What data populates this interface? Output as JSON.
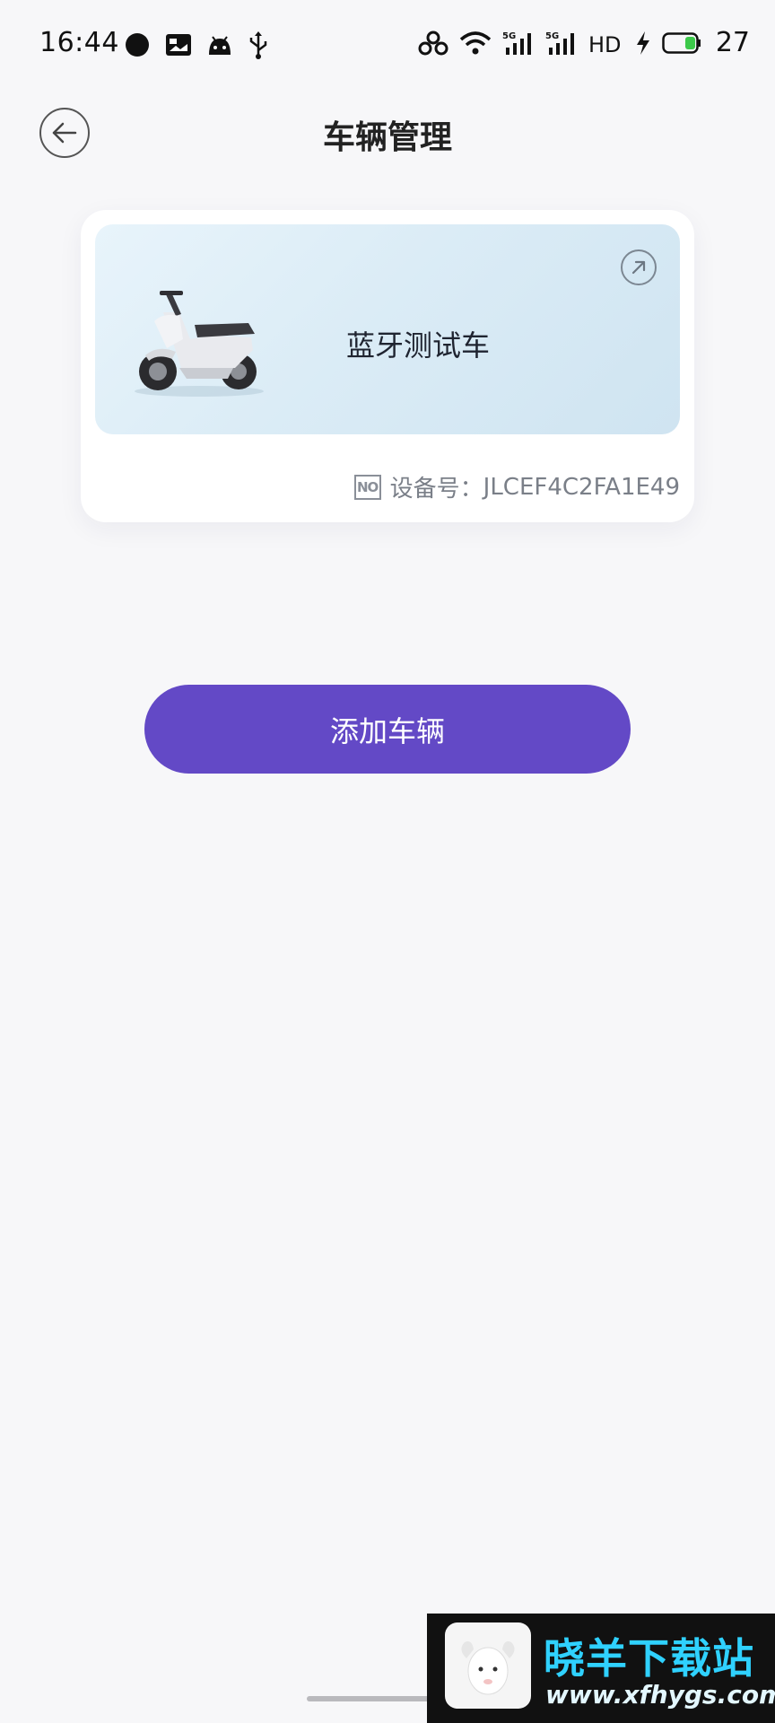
{
  "status_bar": {
    "time": "16:44",
    "battery_level": "27",
    "left_icons": [
      "chat-bubble-icon",
      "image-card-icon",
      "android-icon",
      "usb-icon"
    ],
    "right_icons": [
      "hotspot-icon",
      "wifi-icon",
      "signal-5g-icon",
      "signal-5g-icon",
      "hd-icon",
      "charging-icon",
      "battery-icon"
    ]
  },
  "header": {
    "title": "车辆管理",
    "back_icon": "back-arrow-icon"
  },
  "vehicle_card": {
    "name": "蓝牙测试车",
    "device_label": "设备号：",
    "device_id": "JLCEF4C2FA1E49",
    "badge": "NO",
    "open_icon": "arrow-up-right-icon"
  },
  "actions": {
    "add_vehicle_label": "添加车辆"
  },
  "colors": {
    "primary": "#6349c6",
    "background": "#f7f7f9",
    "card_gradient_start": "#e8f4fb",
    "card_gradient_end": "#cfe4f1"
  },
  "watermark": {
    "title": "晓羊下载站",
    "url": "www.xfhygs.com"
  }
}
